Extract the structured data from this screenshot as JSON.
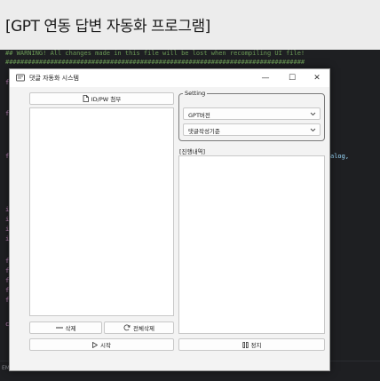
{
  "banner": {
    "title": "[GPT 연동 답변 자동화 프로그램]"
  },
  "editor": {
    "comment_line": "## WARNING! All changes made in this file will be lost when recompiling UI file!",
    "divider_line": "################################################################################",
    "from_kw": "from",
    "import_kw": "import",
    "class_kw": "class",
    "fragment_right_1": "alog,"
  },
  "statusbar": {
    "left_text": "EMS"
  },
  "window": {
    "title": "댓글 자동화 시스템",
    "controls": {
      "minimize": "—",
      "maximize": "☐",
      "close": "✕"
    },
    "attach_button": "ID/PW 첨부",
    "delete_button": "삭제",
    "delete_all_button": "전체삭제",
    "start_button": "시작",
    "stop_button": "정지",
    "setting": {
      "label": "Setting",
      "gpt_version": "GPT버전",
      "comment_criteria": "댓글작성기준"
    },
    "progress_label": "[진행내역]"
  }
}
